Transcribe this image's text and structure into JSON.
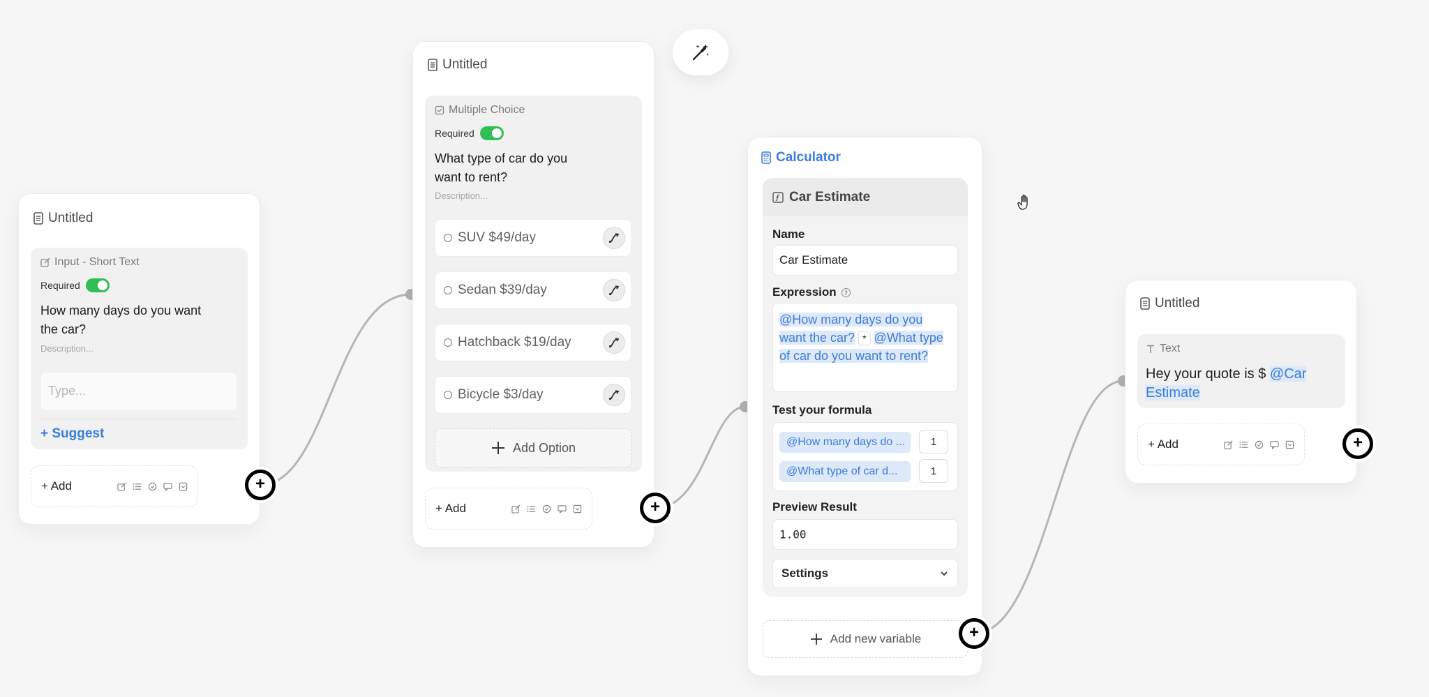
{
  "magic_button": {
    "icon": "magic-wand-icon"
  },
  "node1": {
    "title": "Untitled",
    "type_label": "Input - Short Text",
    "required_label": "Required",
    "question": "How many days do you want the car?",
    "description_placeholder": "Description...",
    "input_placeholder": "Type...",
    "suggest_label": "+ Suggest",
    "add_label": "+ Add"
  },
  "node2": {
    "title": "Untitled",
    "type_label": "Multiple Choice",
    "required_label": "Required",
    "question": "What type of car do you want to rent?",
    "description_placeholder": "Description...",
    "options": [
      {
        "label": "SUV $49/day"
      },
      {
        "label": "Sedan $39/day"
      },
      {
        "label": "Hatchback $19/day"
      },
      {
        "label": "Bicycle $3/day"
      }
    ],
    "add_option_label": "Add Option",
    "add_label": "+ Add"
  },
  "node3": {
    "title": "Calculator",
    "variable_title": "Car Estimate",
    "name_label": "Name",
    "name_value": "Car Estimate",
    "expression_label": "Expression",
    "expression": {
      "part1": "@How many days do you want the car?",
      "operator": "*",
      "part2": "@What type of car do you want to rent?"
    },
    "test_label": "Test your formula",
    "tests": [
      {
        "chip": "@How many days do ...",
        "value": "1"
      },
      {
        "chip": "@What type of car d...",
        "value": "1"
      }
    ],
    "preview_label": "Preview Result",
    "preview_value": "1.00",
    "settings_label": "Settings",
    "add_variable_label": "Add new variable"
  },
  "node4": {
    "title": "Untitled",
    "type_label": "Text",
    "text": "Hey your quote is $",
    "mention": "@Car Estimate",
    "add_label": "+ Add"
  },
  "colors": {
    "accent": "#3b7ddd",
    "toggle_on": "#2fbf55",
    "mention_bg": "#dde8f8"
  }
}
